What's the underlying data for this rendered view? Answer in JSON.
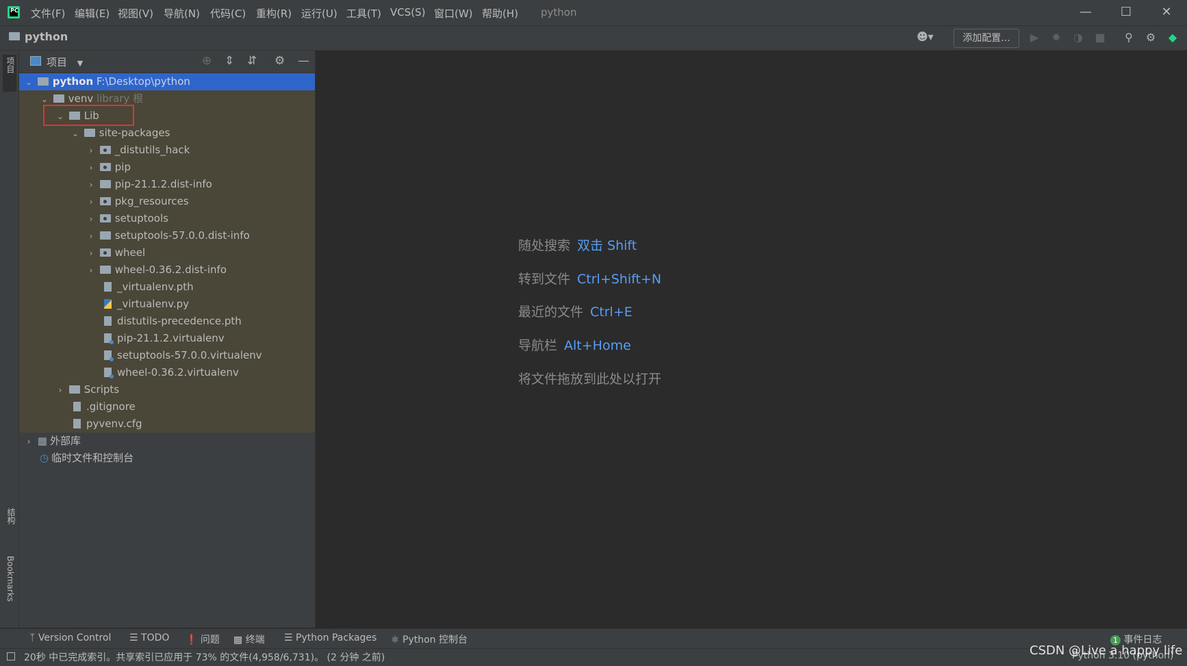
{
  "titlebar": {
    "menus": [
      "文件(F)",
      "编辑(E)",
      "视图(V)",
      "导航(N)",
      "代码(C)",
      "重构(R)",
      "运行(U)",
      "工具(T)",
      "VCS(S)",
      "窗口(W)",
      "帮助(H)"
    ],
    "window_title": "python",
    "minimize_icon": "minimize-icon",
    "maximize_icon": "maximize-icon",
    "close_icon": "close-icon"
  },
  "navbar": {
    "project_name": "python",
    "add_config_label": "添加配置..."
  },
  "left_strip": {
    "project_tab": "项目",
    "structure_tab": "结构",
    "bookmarks_tab": "Bookmarks"
  },
  "project_panel": {
    "header_label": "项目",
    "tree": [
      {
        "label": "python",
        "extra": "F:\\Desktop\\python",
        "expanded": true,
        "type": "folder",
        "selected": true
      },
      {
        "label": "venv",
        "extra": "library 根",
        "expanded": true,
        "type": "folder"
      },
      {
        "label": "Lib",
        "expanded": true,
        "type": "folder",
        "highlighted": true
      },
      {
        "label": "site-packages",
        "expanded": true,
        "type": "folder"
      },
      {
        "label": "_distutils_hack",
        "expanded": false,
        "type": "package"
      },
      {
        "label": "pip",
        "expanded": false,
        "type": "package"
      },
      {
        "label": "pip-21.1.2.dist-info",
        "expanded": false,
        "type": "folder"
      },
      {
        "label": "pkg_resources",
        "expanded": false,
        "type": "package"
      },
      {
        "label": "setuptools",
        "expanded": false,
        "type": "package"
      },
      {
        "label": "setuptools-57.0.0.dist-info",
        "expanded": false,
        "type": "folder"
      },
      {
        "label": "wheel",
        "expanded": false,
        "type": "package"
      },
      {
        "label": "wheel-0.36.2.dist-info",
        "expanded": false,
        "type": "folder"
      },
      {
        "label": "_virtualenv.pth",
        "type": "file"
      },
      {
        "label": "_virtualenv.py",
        "type": "python-file"
      },
      {
        "label": "distutils-precedence.pth",
        "type": "file"
      },
      {
        "label": "pip-21.1.2.virtualenv",
        "type": "virtualenv-file"
      },
      {
        "label": "setuptools-57.0.0.virtualenv",
        "type": "virtualenv-file"
      },
      {
        "label": "wheel-0.36.2.virtualenv",
        "type": "virtualenv-file"
      },
      {
        "label": "Scripts",
        "expanded": false,
        "type": "folder"
      },
      {
        "label": ".gitignore",
        "type": "file"
      },
      {
        "label": "pyvenv.cfg",
        "type": "file"
      },
      {
        "label": "外部库",
        "expanded": false,
        "type": "library"
      },
      {
        "label": "临时文件和控制台",
        "type": "scratch"
      }
    ]
  },
  "editor_hints": [
    {
      "label": "随处搜索",
      "key": "双击 Shift"
    },
    {
      "label": "转到文件",
      "key": "Ctrl+Shift+N"
    },
    {
      "label": "最近的文件",
      "key": "Ctrl+E"
    },
    {
      "label": "导航栏",
      "key": "Alt+Home"
    },
    {
      "label": "将文件拖放到此处以打开",
      "key": ""
    }
  ],
  "tool_windows": [
    "Version Control",
    "TODO",
    "问题",
    "终端",
    "Python Packages",
    "Python 控制台"
  ],
  "event_log": {
    "count": "1",
    "label": "事件日志"
  },
  "status": {
    "message": "20秒 中已完成索引。共享索引已应用于 73% 的文件(4,958/6,731)。 (2 分钟 之前)",
    "interpreter": "Python 3.10 (python)",
    "watermark": "CSDN @Live a happy life"
  },
  "colors": {
    "background": "#2b2b2b",
    "panel": "#3c3f41",
    "selection": "#2f65ca",
    "library_root_bg": "#4a4638",
    "hint_key": "#589df6",
    "highlight_box": "#e03434"
  }
}
